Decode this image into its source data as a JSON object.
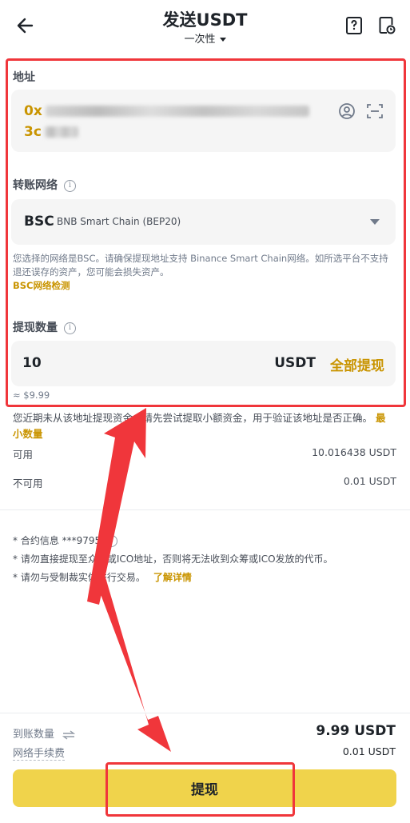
{
  "header": {
    "title": "发送USDT",
    "subtitle": "一次性",
    "back_icon": "arrow-left-icon",
    "help_icon": "question-book-icon",
    "record_icon": "document-clock-icon"
  },
  "address": {
    "label": "地址",
    "line1_prefix": "0x",
    "line2_prefix": "3c",
    "contact_icon": "user-circle-icon",
    "scan_icon": "scan-icon"
  },
  "network": {
    "label": "转账网络",
    "code": "BSC",
    "name": "BNB Smart Chain (BEP20)",
    "note": "您选择的网络是BSC。请确保提现地址支持 Binance Smart Chain网络。如所选平台不支持退还误存的资产，您可能会损失资产。",
    "check_link": "BSC网络检测"
  },
  "amount": {
    "label": "提现数量",
    "value": "10",
    "unit": "USDT",
    "all_button": "全部提现",
    "approx": "≈ $9.99",
    "warning": "您近期未从该地址提现资金。请先尝试提取小额资金，用于验证该地址是否正确。",
    "min_link": "最小数量"
  },
  "balances": {
    "available_label": "可用",
    "available_value": "10.016438 USDT",
    "unavailable_label": "不可用",
    "unavailable_value": "0.01 USDT"
  },
  "tips": {
    "contract": "* 合约信息 ***9795",
    "ico": "* 请勿直接提现至众筹或ICO地址，否则将无法收到众筹或ICO发放的代币。",
    "sanction": "* 请勿与受制裁实体进行交易。",
    "learn_more": "了解详情"
  },
  "footer": {
    "receive_label": "到账数量",
    "receive_value": "9.99 USDT",
    "fee_label": "网络手续费",
    "fee_value": "0.01 USDT",
    "withdraw_button": "提现"
  },
  "colors": {
    "accent": "#f0d34b",
    "gold_text": "#c99400",
    "annotation": "#f0363b"
  }
}
